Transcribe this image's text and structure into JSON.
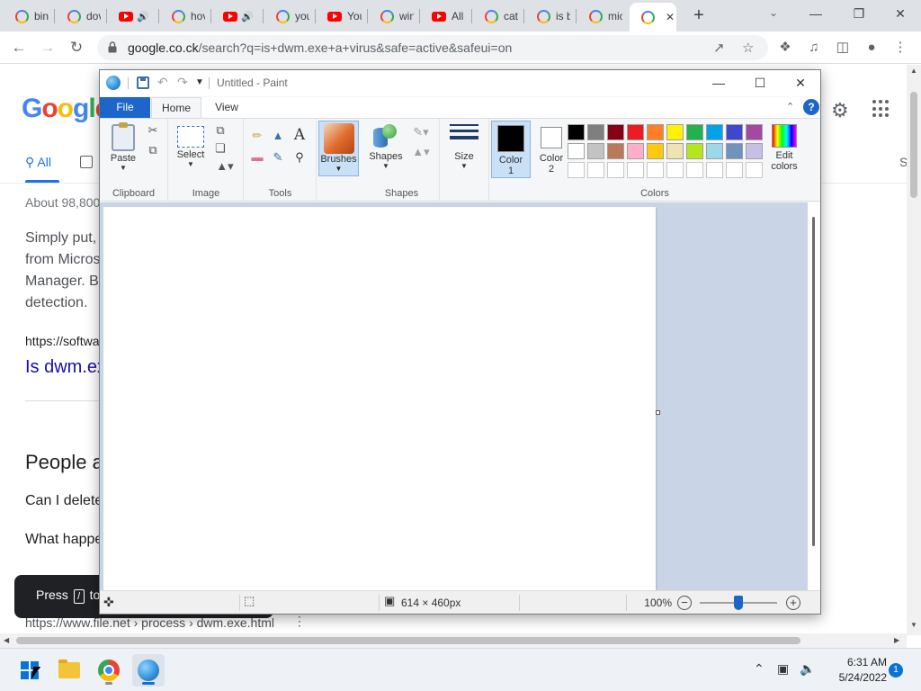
{
  "browser": {
    "tabs": [
      {
        "icon": "google-favicon",
        "label": "bin",
        "audio": false
      },
      {
        "icon": "google-favicon",
        "label": "dov",
        "audio": false
      },
      {
        "icon": "youtube-favicon",
        "label": "",
        "audio": true
      },
      {
        "icon": "google-favicon",
        "label": "hov",
        "audio": false
      },
      {
        "icon": "youtube-favicon",
        "label": "",
        "audio": true
      },
      {
        "icon": "google-favicon",
        "label": "you",
        "audio": false
      },
      {
        "icon": "youtube-favicon",
        "label": "You",
        "audio": false
      },
      {
        "icon": "google-favicon",
        "label": "win",
        "audio": false
      },
      {
        "icon": "youtube-favicon",
        "label": "All",
        "audio": false
      },
      {
        "icon": "google-favicon",
        "label": "cat",
        "audio": false
      },
      {
        "icon": "google-favicon",
        "label": "is b",
        "audio": false
      },
      {
        "icon": "google-favicon",
        "label": "mic",
        "audio": false
      },
      {
        "icon": "google-favicon",
        "label": "",
        "audio": false,
        "active": true
      }
    ],
    "active_tab_close": "✕",
    "new_tab": "+",
    "url_host": "google.co.ck",
    "url_path": "/search?q=is+dwm.exe+a+virus&safe=active&safeui=on",
    "icons": [
      "back-arrow-icon",
      "forward-arrow-icon",
      "reload-icon",
      "lock-icon",
      "share-icon",
      "star-icon",
      "extensions-icon",
      "media-icon",
      "side-panel-icon",
      "profile-icon",
      "menu-icon"
    ]
  },
  "google": {
    "logo": [
      "G",
      "o",
      "o",
      "g",
      "l",
      "e"
    ],
    "tab_all": "All",
    "tab_right": "S",
    "about": "About 98,800",
    "snippet_lines": [
      "Simply put,",
      "from Micros",
      "Manager. B",
      "detection."
    ],
    "result_url": "https://softwa",
    "result_title": "Is dwm.ex",
    "people_also_ask": "People a",
    "questions": [
      "Can I delete",
      "What happe"
    ],
    "toast_prefix": "Press",
    "toast_key": "/",
    "toast_suffix": "to",
    "bottom_url": "https://www.file.net › process › dwm.exe.html"
  },
  "paint": {
    "title": "Untitled - Paint",
    "tabs": {
      "file": "File",
      "home": "Home",
      "view": "View"
    },
    "help": "?",
    "groups": {
      "clipboard": "Clipboard",
      "image": "Image",
      "tools": "Tools",
      "shapes": "Shapes",
      "colors": "Colors"
    },
    "buttons": {
      "paste": "Paste",
      "select": "Select",
      "brushes": "Brushes",
      "shapes": "Shapes",
      "size": "Size",
      "color1_line1": "Color",
      "color1_line2": "1",
      "color2_line1": "Color",
      "color2_line2": "2",
      "edit_colors_line1": "Edit",
      "edit_colors_line2": "colors"
    },
    "color1": "#000000",
    "color2": "#ffffff",
    "palette_row1": [
      "#000000",
      "#7f7f7f",
      "#880015",
      "#ed1c24",
      "#ff7f27",
      "#fff200",
      "#22b14c",
      "#00a2e8",
      "#3f48cc",
      "#a349a4"
    ],
    "palette_row2": [
      "#ffffff",
      "#c3c3c3",
      "#b97a57",
      "#ffaec9",
      "#ffc90e",
      "#efe4b0",
      "#b5e61d",
      "#99d9ea",
      "#7092be",
      "#c8bfe7"
    ],
    "palette_row3": [
      "#ffffff",
      "#ffffff",
      "#ffffff",
      "#ffffff",
      "#ffffff",
      "#ffffff",
      "#ffffff",
      "#ffffff",
      "#ffffff",
      "#ffffff"
    ],
    "status": {
      "canvas_size": "614 × 460px",
      "zoom": "100%",
      "zoom_level_percent": 100
    }
  },
  "taskbar": {
    "time": "6:31 AM",
    "date": "5/24/2022",
    "notification_count": "1",
    "apps": [
      "windows-start-icon",
      "file-explorer-icon",
      "chrome-icon",
      "paint-icon"
    ]
  }
}
